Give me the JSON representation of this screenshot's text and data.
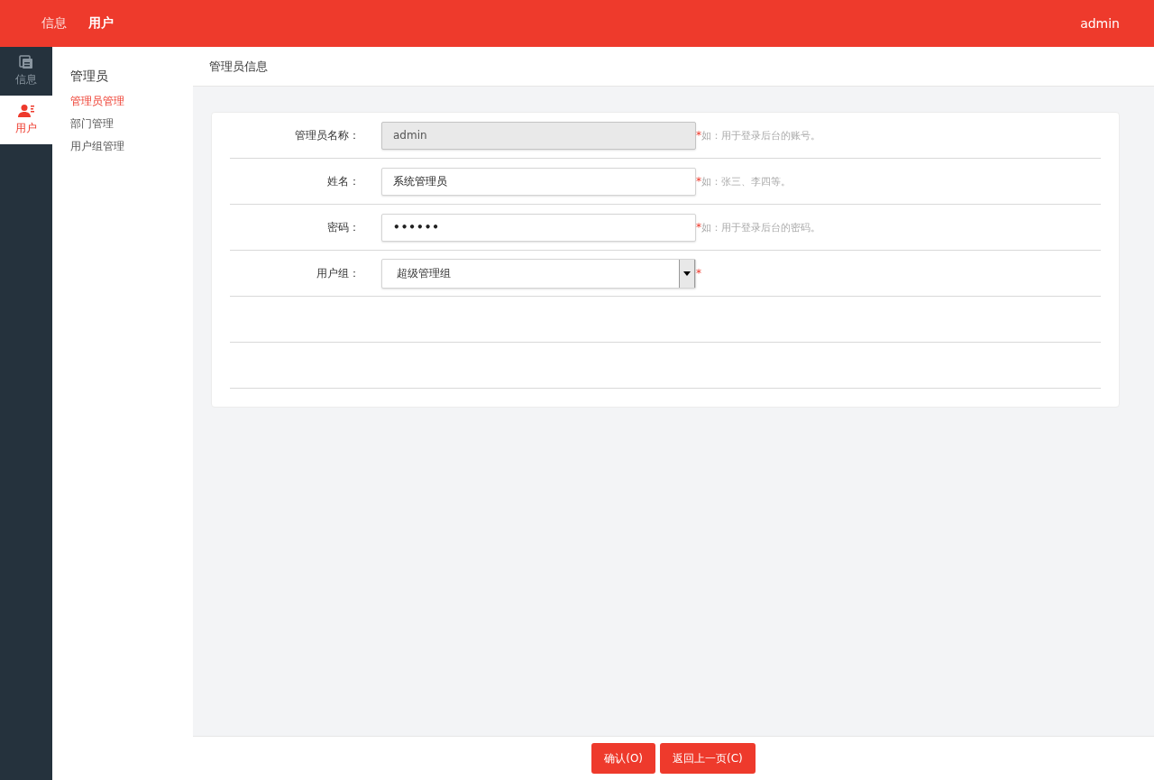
{
  "top_nav": {
    "items": [
      {
        "label": "信息",
        "selected": false
      },
      {
        "label": "用户",
        "selected": true
      }
    ],
    "user": "admin"
  },
  "rail": {
    "items": [
      {
        "label": "信息",
        "kind": "doc",
        "selected": false
      },
      {
        "label": "用户",
        "kind": "user",
        "selected": true
      }
    ]
  },
  "sub_nav": {
    "title": "管理员",
    "items": [
      {
        "label": "管理员管理",
        "selected": true
      },
      {
        "label": "部门管理",
        "selected": false
      },
      {
        "label": "用户组管理",
        "selected": false
      }
    ]
  },
  "page_title": "管理员信息",
  "form": {
    "fields": [
      {
        "kind": "text",
        "label": "管理员名称：",
        "value": "admin",
        "disabled": true,
        "mark": "*",
        "hint": "如：用于登录后台的账号。"
      },
      {
        "kind": "text",
        "label": "姓名：",
        "value": "系统管理员",
        "disabled": false,
        "mark": "*",
        "hint": "如：张三、李四等。"
      },
      {
        "kind": "password",
        "label": "密码：",
        "value": "••••••",
        "disabled": false,
        "mark": "*",
        "hint": " 如：用于登录后台的密码。"
      },
      {
        "kind": "select",
        "label": "用户组：",
        "value": "超级管理组",
        "disabled": false,
        "mark": "*"
      }
    ]
  },
  "buttons": [
    "确认(O)",
    "返回上一页(C)"
  ]
}
